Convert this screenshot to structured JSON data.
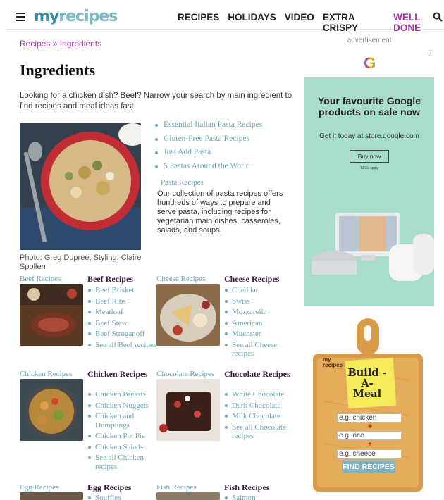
{
  "header": {
    "logo_my": "my",
    "logo_recipes": "recipes",
    "nav": [
      "RECIPES",
      "HOLIDAYS",
      "VIDEO",
      "EXTRA CRISPY",
      "WELL DONE"
    ],
    "accent_color": "#a533a0"
  },
  "breadcrumb": "Recipes » Ingredients",
  "title": "Ingredients",
  "intro": "Looking for a chicken dish? Beef? Narrow your search by main ingredient to find recipes and meal ideas fast.",
  "featured": {
    "links": [
      "Essential Italian Pasta Recipes",
      "Gluten-Free Pasta Recipes",
      "Just Add Pasta",
      "5 Pastas Around the World"
    ],
    "title": "Pasta Recipes",
    "description": "Our collection of pasta recipes offers hundreds of ways to prepare and serve pasta, including recipes for vegetarian main dishes, casseroles, salads, and soups.",
    "credit": "Photo: Greg Dupree; Styling: Claire Spollen"
  },
  "categories": [
    {
      "thumb_label": "Beef Recipes",
      "title": "Beef Recipes",
      "items": [
        "Beef Brisket",
        "Beef Ribs",
        "Meatloaf",
        "Beef Stew",
        "Beef Stroganoff",
        "See all Beef recipes"
      ]
    },
    {
      "thumb_label": "Cheese Recipes",
      "title": "Cheese Recipes",
      "items": [
        "Cheddar",
        "Swiss",
        "Mozzarella",
        "American",
        "Muenster",
        "See all Cheese recipes"
      ]
    },
    {
      "thumb_label": "Chicken Recipes",
      "title": "Chicken Recipes",
      "items": [
        "Chicken Breasts",
        "Chicken Nuggets",
        "Chicken and Dumplings",
        "Chicken Pot Pie",
        "Chicken Salads",
        "See all Chicken recipes"
      ]
    },
    {
      "thumb_label": "Chocolate Recipes",
      "title": "Chocolate Recipes",
      "items": [
        "White Chocolate",
        "Dark Chocolate",
        "Milk Chocolate",
        "See all Chocolate recipes"
      ]
    },
    {
      "thumb_label": "Egg Recipes",
      "title": "Egg Recipes",
      "items": [
        "Souffles"
      ]
    },
    {
      "thumb_label": "Fish Recipes",
      "title": "Fish Recipes",
      "items": [
        "Salmon"
      ]
    }
  ],
  "ad": {
    "label": "advertisement",
    "logo": "G",
    "info": "ⓘ",
    "headline": "Your favourite Google products on sale now",
    "sub": "Get it today at store.google.com",
    "button": "Buy now",
    "tc": "T&Cs apply"
  },
  "build_meal": {
    "brand_line1": "my",
    "brand_line2": "recipes",
    "note": "Build -A- Meal",
    "field1_placeholder": "e.g. chicken",
    "field2_placeholder": "e.g. rice",
    "field3_placeholder": "e.g. cheese",
    "plus": "+",
    "button": "FIND RECIPES"
  }
}
